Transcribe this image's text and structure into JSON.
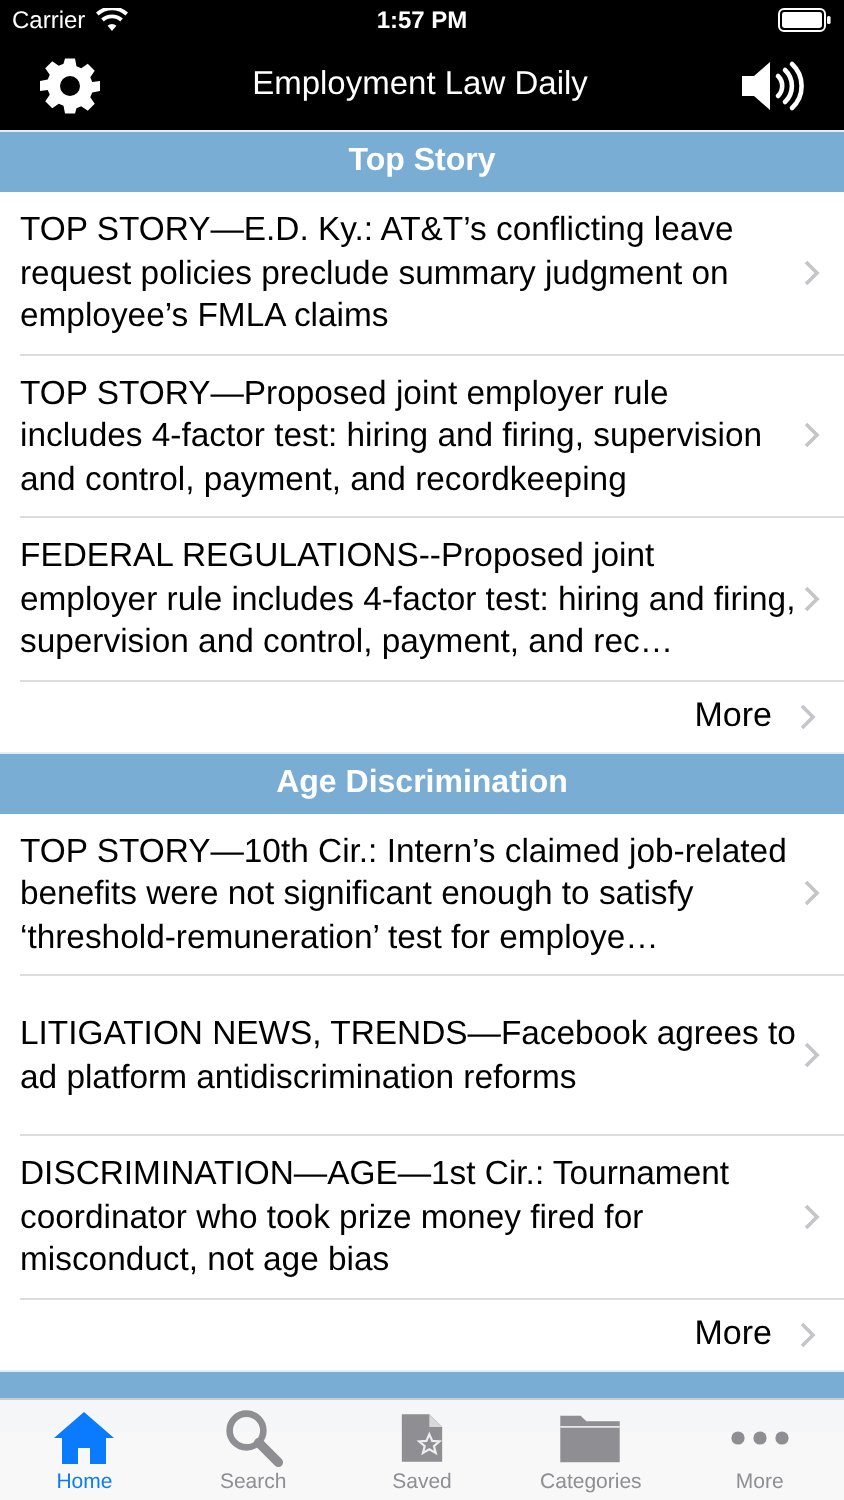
{
  "status_bar": {
    "carrier": "Carrier",
    "time": "1:57 PM"
  },
  "nav_bar": {
    "title": "Employment Law Daily"
  },
  "sections": [
    {
      "title": "Top Story",
      "items": [
        {
          "text": "TOP STORY—E.D. Ky.: AT&T’s conflicting leave request policies preclude summary judgment on employee’s FMLA claims"
        },
        {
          "text": "TOP STORY—Proposed joint employer rule includes 4-factor test: hiring and firing, supervision and control, payment, and recordkeeping"
        },
        {
          "text": "FEDERAL REGULATIONS--Proposed joint employer rule includes 4-factor test: hiring and firing, supervision and control, payment, and rec…"
        }
      ],
      "more": "More"
    },
    {
      "title": "Age Discrimination",
      "items": [
        {
          "text": "TOP STORY—10th Cir.: Intern’s claimed job-related benefits were not significant enough to satisfy ‘threshold-remuneration’ test for employe…"
        },
        {
          "text": "LITIGATION NEWS, TRENDS—Facebook agrees to ad platform antidiscrimination reforms"
        },
        {
          "text": "DISCRIMINATION—AGE—1st Cir.: Tournament coordinator who took prize money fired for misconduct, not age bias"
        }
      ],
      "more": "More"
    }
  ],
  "tab_bar": [
    {
      "kind": "home",
      "label": "Home",
      "selected": true
    },
    {
      "kind": "search",
      "label": "Search",
      "selected": false
    },
    {
      "kind": "saved",
      "label": "Saved",
      "selected": false
    },
    {
      "kind": "categories",
      "label": "Categories",
      "selected": false
    },
    {
      "kind": "more",
      "label": "More",
      "selected": false
    }
  ]
}
